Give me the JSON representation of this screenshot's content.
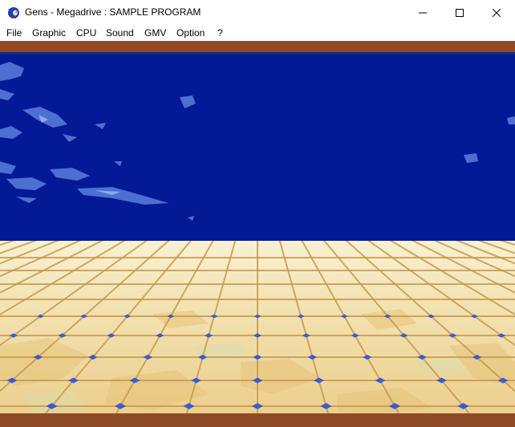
{
  "window": {
    "title": "Gens - Megadrive : SAMPLE PROGRAM",
    "app_icon": "sonic-icon",
    "controls": [
      "minimize-icon",
      "maximize-icon",
      "close-icon"
    ]
  },
  "menu": {
    "items": [
      {
        "label": "File"
      },
      {
        "label": "Graphic"
      },
      {
        "label": "CPU"
      },
      {
        "label": "Sound"
      },
      {
        "label": "GMV"
      },
      {
        "label": "Option"
      },
      {
        "label": "?"
      }
    ]
  },
  "game": {
    "colors": {
      "border": "#8e4a26",
      "sky": "#031996",
      "cloud": "#4d6fd2",
      "floor_light": "#f6eecb",
      "floor_tile": "#efd79c",
      "grout": "#c89a4c",
      "cross": "#3c5bd2"
    }
  }
}
